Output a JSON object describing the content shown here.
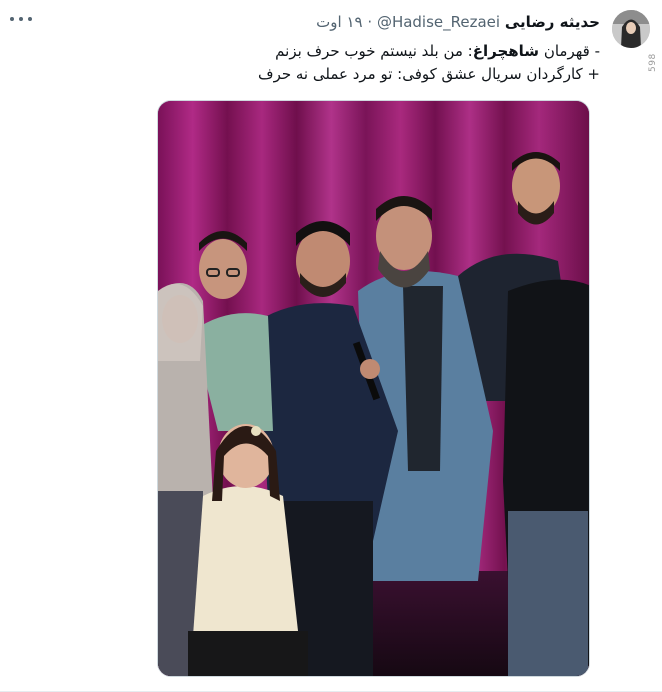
{
  "tweet": {
    "author_name": "حدیثه رضایی",
    "handle": "@Hadise_Rezaei",
    "separator": "·",
    "date": "۱۹ اوت",
    "more_icon": "more-horizontal-icon",
    "text_lines": [
      {
        "prefix": "- قهرمان ",
        "bold": "شاهچراغ",
        "suffix": ": من بلد نیستم خوب حرف بزنم"
      },
      {
        "prefix": "+ کارگردان سریال عشق کوفی: تو مرد عملی نه حرف",
        "bold": "",
        "suffix": ""
      }
    ],
    "watermark": "598"
  },
  "colors": {
    "curtain": "#8a1a6a",
    "text_primary": "#0f1419",
    "text_secondary": "#536471",
    "border": "#cfd9de"
  }
}
